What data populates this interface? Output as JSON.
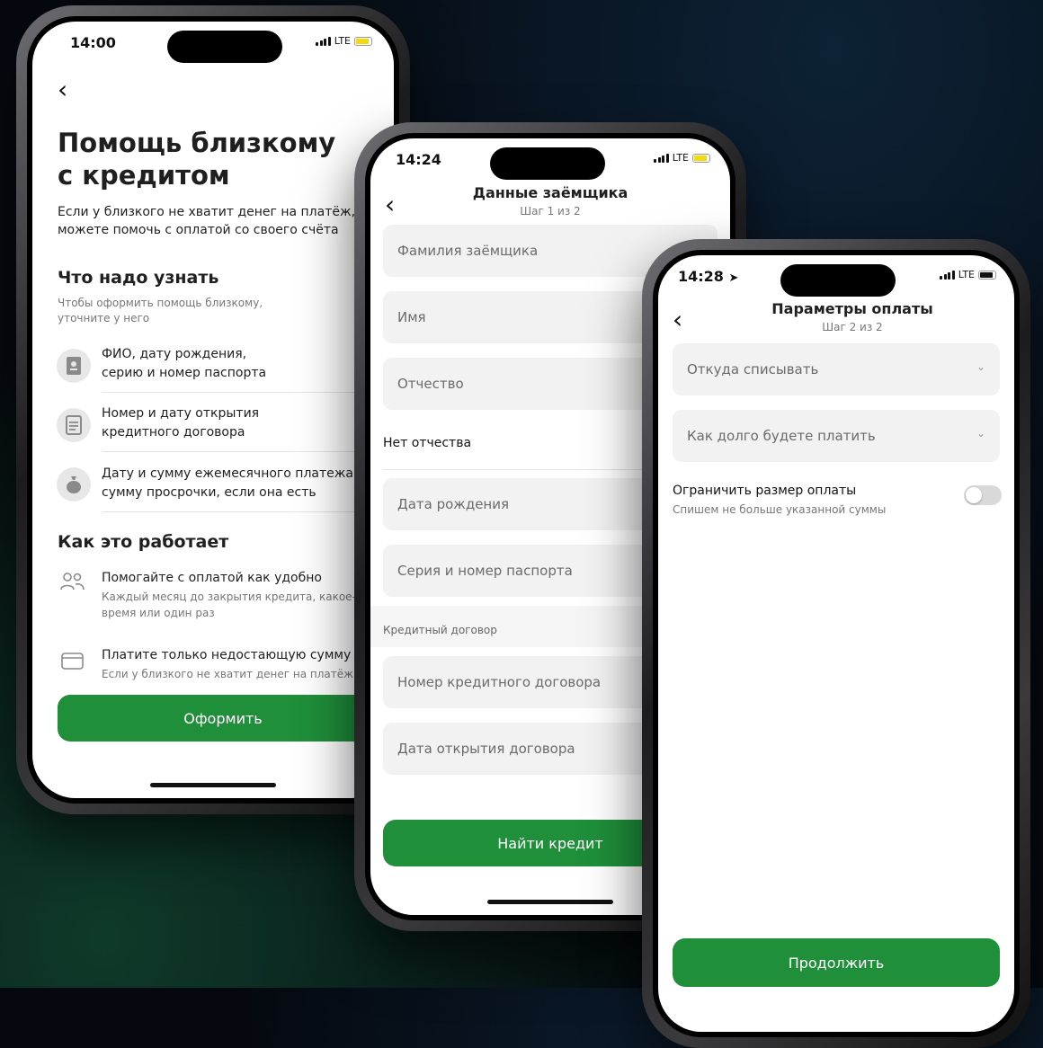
{
  "screen1": {
    "time": "14:00",
    "network": "LTE",
    "title_line1": "Помощь близкому",
    "title_line2": "с кредитом",
    "intro_line1": "Если у близкого не хватит денег на платёж, вы",
    "intro_line2": "можете помочь с оплатой со своего счёта",
    "section1_title": "Что надо узнать",
    "section1_sub_line1": "Чтобы оформить помощь близкому,",
    "section1_sub_line2": "уточните у него",
    "needs": [
      {
        "icon": "passport-icon",
        "line1": "ФИО, дату рождения,",
        "line2": "серию и номер паспорта"
      },
      {
        "icon": "document-icon",
        "line1": "Номер и дату открытия",
        "line2": "кредитного договора"
      },
      {
        "icon": "money-bag-icon",
        "line1": "Дату и сумму ежемесячного платежа и",
        "line2": "сумму просрочки, если она есть"
      }
    ],
    "section2_title": "Как это работает",
    "how": [
      {
        "icon": "people-icon",
        "title": "Помогайте с оплатой как удобно",
        "desc_line1": "Каждый месяц до закрытия кредита, какое-то",
        "desc_line2": "время или один раз"
      },
      {
        "icon": "wallet-icon",
        "title": "Платите только недостающую сумму",
        "desc_line1": "Если у близкого не хватит денег на платёж,",
        "desc_line2": ""
      }
    ],
    "button": "Оформить",
    "battery_color": "#f5d90a"
  },
  "screen2": {
    "time": "14:24",
    "network": "LTE",
    "title": "Данные заёмщика",
    "step": "Шаг 1 из 2",
    "fields": {
      "surname": "Фамилия заёмщика",
      "name": "Имя",
      "patronymic": "Отчество",
      "no_patronymic": "Нет отчества",
      "birth_date": "Дата рождения",
      "passport": "Серия и номер паспорта",
      "section_credit": "Кредитный договор",
      "contract_number": "Номер кредитного договора",
      "contract_date": "Дата открытия договора"
    },
    "button": "Найти кредит",
    "battery_color": "#f5d90a"
  },
  "screen3": {
    "time": "14:28",
    "network": "LTE",
    "title": "Параметры оплаты",
    "step": "Шаг 2 из 2",
    "select1": "Откуда списывать",
    "select2": "Как долго будете платить",
    "toggle_label": "Ограничить размер оплаты",
    "toggle_desc": "Спишем не больше указанной суммы",
    "toggle_on": false,
    "button": "Продолжить",
    "battery_color": "#111111"
  },
  "colors": {
    "accent_green": "#1f8f3a",
    "field_bg": "#f2f2f2"
  }
}
